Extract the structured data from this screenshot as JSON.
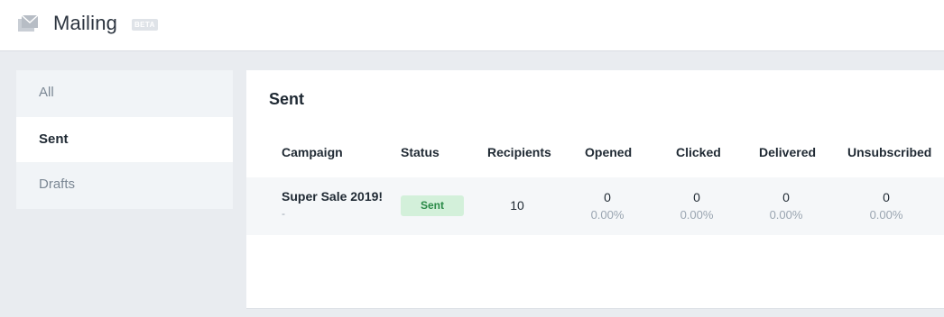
{
  "header": {
    "title": "Mailing",
    "badge": "BETA",
    "icon": "mail-stack-icon"
  },
  "sidebar": {
    "items": [
      {
        "label": "All",
        "active": false
      },
      {
        "label": "Sent",
        "active": true
      },
      {
        "label": "Drafts",
        "active": false
      }
    ]
  },
  "main": {
    "title": "Sent",
    "columns": [
      "Campaign",
      "Status",
      "Recipients",
      "Opened",
      "Clicked",
      "Delivered",
      "Unsubscribed"
    ],
    "rows": [
      {
        "campaign": "Super Sale 2019!",
        "subtitle": "-",
        "status": "Sent",
        "recipients": "10",
        "opened": {
          "count": "0",
          "rate": "0.00%"
        },
        "clicked": {
          "count": "0",
          "rate": "0.00%"
        },
        "delivered": {
          "count": "0",
          "rate": "0.00%"
        },
        "unsubscribed": {
          "count": "0",
          "rate": "0.00%"
        }
      }
    ]
  },
  "colors": {
    "status_sent_bg": "#d3f0da",
    "status_sent_text": "#2a8a47"
  }
}
